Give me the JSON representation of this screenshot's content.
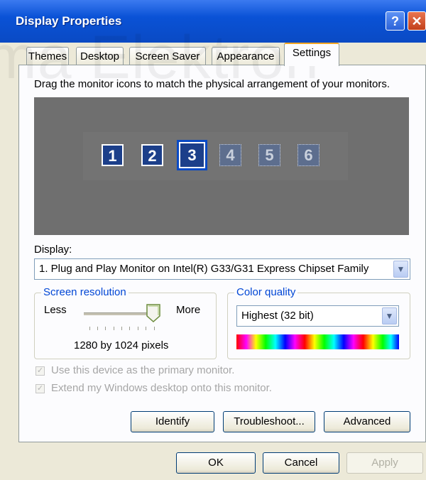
{
  "window": {
    "title": "Display Properties",
    "help_glyph": "?",
    "close_glyph": "✕"
  },
  "watermark": "ima Elektron",
  "tabs": [
    {
      "label": "Themes"
    },
    {
      "label": "Desktop"
    },
    {
      "label": "Screen Saver"
    },
    {
      "label": "Appearance"
    },
    {
      "label": "Settings",
      "active": true
    }
  ],
  "settings": {
    "drag_instruction": "Drag the monitor icons to match the physical arrangement of your monitors.",
    "monitors": [
      {
        "number": "1",
        "state": "active"
      },
      {
        "number": "2",
        "state": "active"
      },
      {
        "number": "3",
        "state": "selected"
      },
      {
        "number": "4",
        "state": "inactive"
      },
      {
        "number": "5",
        "state": "inactive"
      },
      {
        "number": "6",
        "state": "inactive"
      }
    ],
    "display_label": "Display:",
    "display_value": "1. Plug and Play Monitor on Intel(R) G33/G31 Express Chipset Family",
    "resolution": {
      "legend": "Screen resolution",
      "less_label": "Less",
      "more_label": "More",
      "value_text": "1280 by 1024 pixels",
      "slider_fraction": 0.92
    },
    "color_quality": {
      "legend": "Color quality",
      "value": "Highest (32 bit)"
    },
    "checkboxes": [
      {
        "label": "Use this device as the primary monitor.",
        "checked": true,
        "enabled": false
      },
      {
        "label": "Extend my Windows desktop onto this monitor.",
        "checked": true,
        "enabled": false
      }
    ],
    "buttons": {
      "identify": "Identify",
      "troubleshoot": "Troubleshoot...",
      "advanced": "Advanced"
    }
  },
  "dialog_buttons": {
    "ok": "OK",
    "cancel": "Cancel",
    "apply": "Apply"
  },
  "colors": {
    "title_bar": "#0a52d6",
    "tab_highlight": "#f5a623",
    "monitor_area": "#6f6f6f",
    "monitor_active": "#1c3f8a",
    "monitor_selected_border": "#0a4ac4",
    "legend_text": "#0046d5"
  },
  "icons": {
    "dropdown": "chevron-down-icon",
    "checkbox_check": "checkmark-icon"
  }
}
